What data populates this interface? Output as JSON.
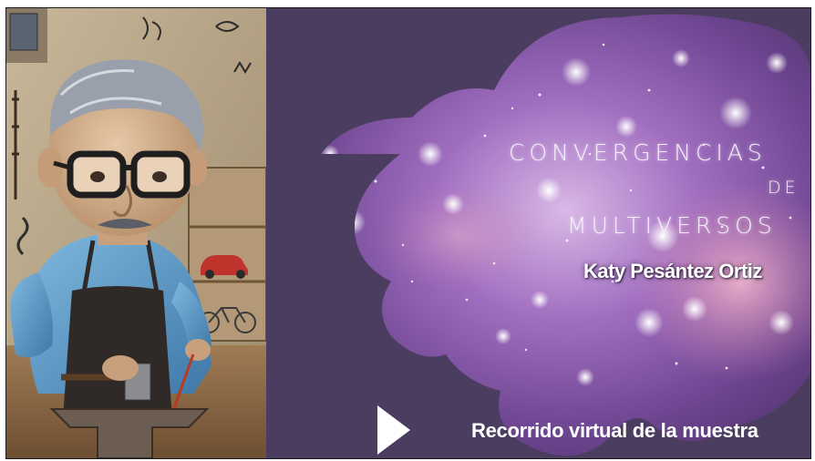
{
  "slide": {
    "title_line1": "CONVERGENCIAS",
    "title_line2": "DE",
    "title_line3": "MULTIVERSOS",
    "author": "Katy Pesántez Ortiz",
    "cta_label": "Recorrido virtual de la muestra"
  },
  "colors": {
    "panel_bg": "#4b3d60",
    "nebula_purple": "#8a5aa8",
    "nebula_pink": "#c87ca8",
    "title_text": "#f4eefa",
    "cta_text": "#ffffff"
  },
  "icons": {
    "play": "play-triangle-icon"
  }
}
